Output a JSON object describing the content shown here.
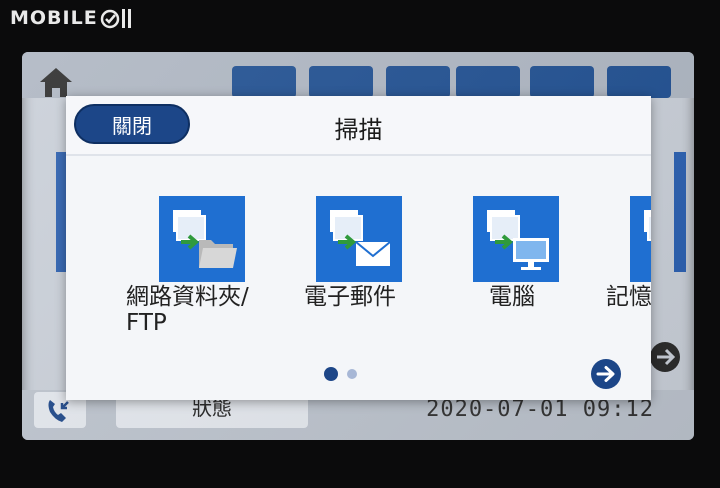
{
  "watermark": {
    "text": "MOBILE"
  },
  "background": {
    "status_label": "狀態",
    "datetime": "2020-07-01 09:12"
  },
  "dialog": {
    "close_label": "關閉",
    "title": "掃描",
    "items": [
      {
        "label_line1": "網路資料夾/",
        "label_line2": "FTP",
        "icon": "folder-scan-icon"
      },
      {
        "label_line1": "電子郵件",
        "label_line2": "",
        "icon": "email-scan-icon"
      },
      {
        "label_line1": "電腦",
        "label_line2": "",
        "icon": "computer-scan-icon"
      },
      {
        "label_line1": "記憶",
        "label_line2": "",
        "icon": "memory-scan-icon"
      }
    ],
    "pager": {
      "current": 1,
      "total": 2
    }
  },
  "colors": {
    "accent": "#1c4688",
    "tile": "#1f6fd1",
    "arrow_green": "#2f9a3c"
  }
}
